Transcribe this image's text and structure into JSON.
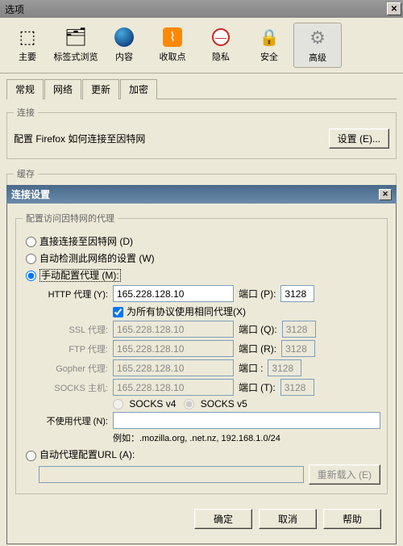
{
  "window_title": "选项",
  "toolbar": [
    {
      "name": "main",
      "label": "主要"
    },
    {
      "name": "tabs",
      "label": "标签式浏览"
    },
    {
      "name": "content",
      "label": "内容"
    },
    {
      "name": "feeds",
      "label": "收取点"
    },
    {
      "name": "privacy",
      "label": "隐私"
    },
    {
      "name": "security",
      "label": "安全"
    },
    {
      "name": "advanced",
      "label": "高级"
    }
  ],
  "subtabs": [
    "常规",
    "网络",
    "更新",
    "加密"
  ],
  "connection_group": {
    "legend": "连接",
    "desc": "配置 Firefox 如何连接至因特网",
    "settings_btn": "设置 (E)..."
  },
  "cache_legend": "缓存",
  "modal": {
    "title": "连接设置",
    "legend": "配置访问因特网的代理",
    "radios": {
      "direct": "直接连接至因特网 (D)",
      "auto": "自动检测此网络的设置 (W)",
      "manual": "手动配置代理 (M):",
      "auto_url": "自动代理配置URL (A):"
    },
    "labels": {
      "http": "HTTP 代理 (Y):",
      "ssl": "SSL 代理:",
      "ftp": "FTP 代理:",
      "gopher": "Gopher 代理:",
      "socks": "SOCKS 主机:",
      "noproxy": "不使用代理 (N):",
      "port": "端口",
      "port_p": "(P):",
      "port_o": "(Q):",
      "port_r": "(R):",
      "port_g": ":",
      "port_t": "(T):"
    },
    "shared_checkbox": "为所有协议使用相同代理(X)",
    "example": "例如：.mozilla.org, .net.nz, 192.168.1.0/24",
    "socks_v4": "SOCKS v4",
    "socks_v5": "SOCKS v5",
    "reload_btn": "重新载入 (E)",
    "host": "165.228.128.10",
    "port": "3128"
  },
  "buttons": {
    "ok": "确定",
    "cancel": "取消",
    "help": "帮助"
  }
}
